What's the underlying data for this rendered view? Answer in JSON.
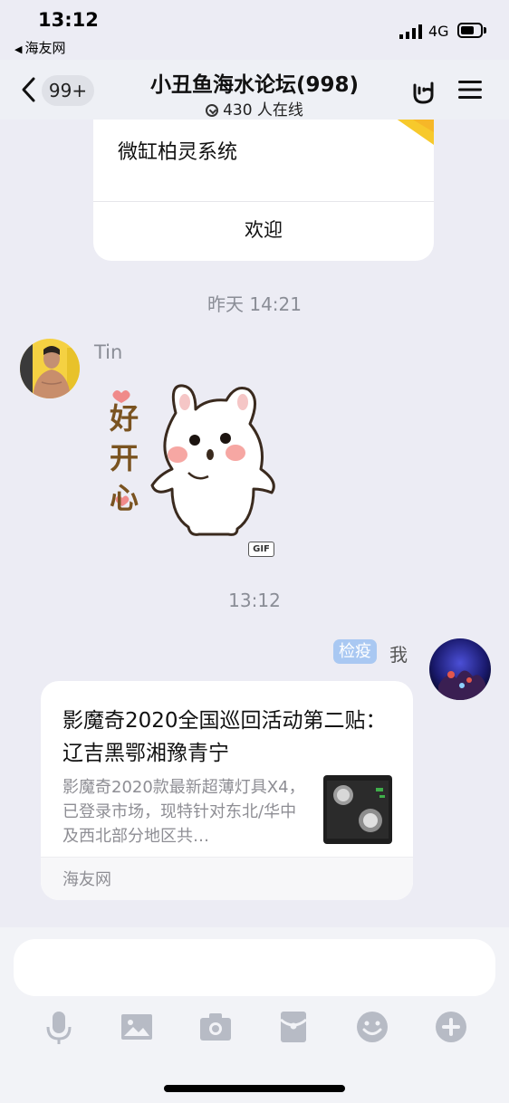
{
  "status_bar": {
    "time": "13:12",
    "back_app": "海友网",
    "network": "4G"
  },
  "nav": {
    "unread_badge": "99+",
    "title": "小丑鱼海水论坛(998)",
    "online": "430 人在线"
  },
  "messages": {
    "top_card": {
      "title": "微缸柏灵系统",
      "action": "欢迎"
    },
    "timestamp_1": "昨天 14:21",
    "incoming": {
      "sender": "Tin",
      "sticker": {
        "text_lines": [
          "好",
          "开",
          "心"
        ],
        "badge": "GIF"
      }
    },
    "timestamp_2": "13:12",
    "outgoing": {
      "tag": "检疫",
      "sender": "我",
      "share": {
        "title": "影魔奇2020全国巡回活动第二贴： 辽吉黑鄂湘豫青宁",
        "description": "影魔奇2020款最新超薄灯具X4，已登录市场，现特针对东北/华中及西北部分地区共…",
        "source": "海友网"
      }
    }
  },
  "input": {
    "placeholder": ""
  },
  "toolbar": [
    "microphone-icon",
    "image-icon",
    "camera-icon",
    "red-packet-icon",
    "emoji-icon",
    "plus-icon"
  ],
  "colors": {
    "background": "#ececf4",
    "tag_blue": "#a9c8f2",
    "muted_text": "#8a8d96"
  }
}
